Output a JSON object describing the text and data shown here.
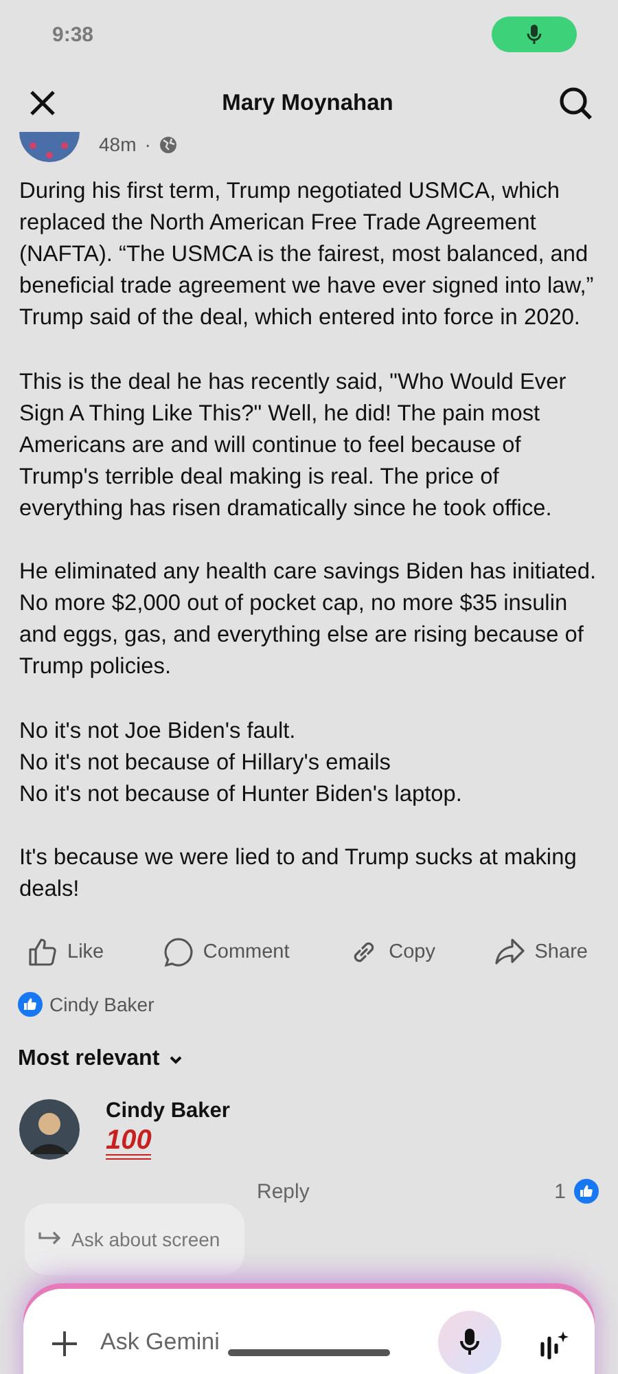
{
  "status_bar": {
    "time": "9:38"
  },
  "header": {
    "title": "Mary Moynahan"
  },
  "post": {
    "time": "48m",
    "separator": "·",
    "paragraphs": [
      [
        "During his first term, Trump negotiated USMCA, which replaced the North American Free Trade Agreement (NAFTA). “The USMCA is the fairest, most balanced, and beneficial trade agreement we have ever signed into law,” Trump said of the deal, which entered into force in 2020."
      ],
      [
        "This is the deal he has recently said,  \"Who Would Ever Sign A Thing Like This?\" Well, he did! The pain most Americans are and will continue to feel because of Trump's terrible deal making is real. The price of everything has risen dramatically since he took office."
      ],
      [
        "He eliminated any health care savings Biden has initiated. No more $2,000 out of pocket cap, no more $35 insulin and eggs, gas, and everything else are rising because of Trump policies."
      ],
      [
        "No it's not Joe Biden's fault.",
        "No it's not because of Hillary's emails",
        "No it's not because of Hunter Biden's laptop."
      ],
      [
        "It's because we were lied to and Trump sucks at making deals!"
      ]
    ],
    "actions": [
      {
        "kind": "like",
        "label": "Like"
      },
      {
        "kind": "comment",
        "label": "Comment"
      },
      {
        "kind": "copy",
        "label": "Copy"
      },
      {
        "kind": "share",
        "label": "Share"
      }
    ],
    "likers": "Cindy Baker"
  },
  "comments": {
    "sort": "Most relevant",
    "items": [
      {
        "author": "Cindy Baker",
        "text": "100",
        "reply": "Reply",
        "reactions": "1"
      }
    ]
  },
  "gemini": {
    "chip": "Ask about screen",
    "placeholder": "Ask Gemini"
  }
}
